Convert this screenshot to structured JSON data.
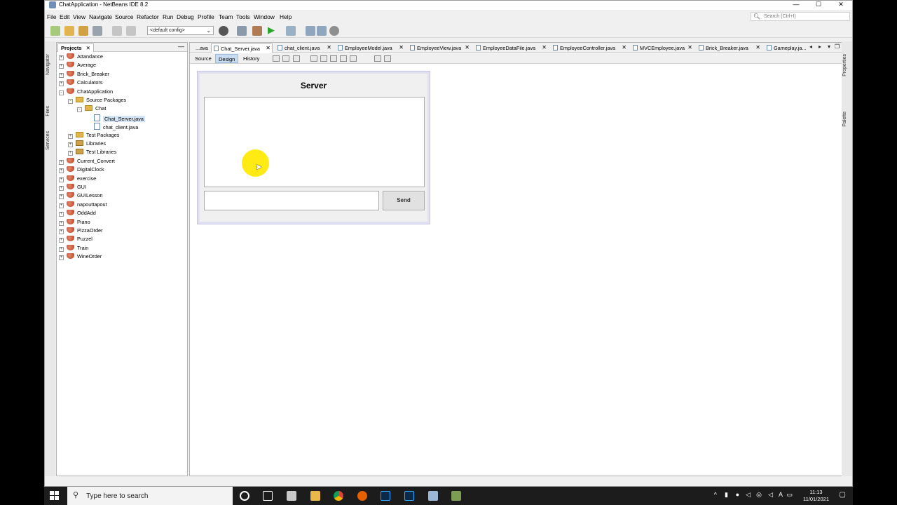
{
  "window": {
    "title": "ChatApplication - NetBeans IDE 8.2"
  },
  "menubar": {
    "items": [
      "File",
      "Edit",
      "View",
      "Navigate",
      "Source",
      "Refactor",
      "Run",
      "Debug",
      "Profile",
      "Team",
      "Tools",
      "Window",
      "Help"
    ],
    "search_placeholder": "Search (Ctrl+I)"
  },
  "toolbar": {
    "config": "<default config>"
  },
  "side_tabs": {
    "left": [
      "Navigator",
      "Files",
      "Services"
    ],
    "right": [
      "Properties",
      "Palette"
    ]
  },
  "projects": {
    "tab_label": "Projects",
    "tree": [
      {
        "label": "Attandance",
        "depth": 0,
        "kind": "project",
        "expander": "+"
      },
      {
        "label": "Average",
        "depth": 0,
        "kind": "project",
        "expander": "+"
      },
      {
        "label": "Brick_Breaker",
        "depth": 0,
        "kind": "project",
        "expander": "+"
      },
      {
        "label": "Calculators",
        "depth": 0,
        "kind": "project",
        "expander": "+"
      },
      {
        "label": "ChatApplication",
        "depth": 0,
        "kind": "project",
        "expander": "-"
      },
      {
        "label": "Source Packages",
        "depth": 1,
        "kind": "folder",
        "expander": "-"
      },
      {
        "label": "Chat",
        "depth": 2,
        "kind": "folder",
        "expander": "-"
      },
      {
        "label": "Chat_Server.java",
        "depth": 3,
        "kind": "file",
        "expander": "",
        "selected": true
      },
      {
        "label": "chat_client.java",
        "depth": 3,
        "kind": "file",
        "expander": ""
      },
      {
        "label": "Test Packages",
        "depth": 1,
        "kind": "folder",
        "expander": "+"
      },
      {
        "label": "Libraries",
        "depth": 1,
        "kind": "lib",
        "expander": "+"
      },
      {
        "label": "Test Libraries",
        "depth": 1,
        "kind": "lib",
        "expander": "+"
      },
      {
        "label": "Current_Convert",
        "depth": 0,
        "kind": "project",
        "expander": "+"
      },
      {
        "label": "DigitalClock",
        "depth": 0,
        "kind": "project",
        "expander": "+"
      },
      {
        "label": "exercise",
        "depth": 0,
        "kind": "project",
        "expander": "+"
      },
      {
        "label": "GUI",
        "depth": 0,
        "kind": "project",
        "expander": "+"
      },
      {
        "label": "GUILesson",
        "depth": 0,
        "kind": "project",
        "expander": "+"
      },
      {
        "label": "napouttapout",
        "depth": 0,
        "kind": "project",
        "expander": "+"
      },
      {
        "label": "OddAdd",
        "depth": 0,
        "kind": "project",
        "expander": "+"
      },
      {
        "label": "Piano",
        "depth": 0,
        "kind": "project",
        "expander": "+"
      },
      {
        "label": "PizzaOrder",
        "depth": 0,
        "kind": "project",
        "expander": "+"
      },
      {
        "label": "Puzzel",
        "depth": 0,
        "kind": "project",
        "expander": "+"
      },
      {
        "label": "Train",
        "depth": 0,
        "kind": "project",
        "expander": "+"
      },
      {
        "label": "WineOrder",
        "depth": 0,
        "kind": "project",
        "expander": "+"
      }
    ]
  },
  "editor": {
    "tabs": [
      {
        "label": "...ava",
        "close": false
      },
      {
        "label": "Chat_Server.java",
        "active": true
      },
      {
        "label": "chat_client.java"
      },
      {
        "label": "EmployeeModel.java"
      },
      {
        "label": "EmployeeView.java"
      },
      {
        "label": "EmployeeDataFile.java"
      },
      {
        "label": "EmployeeController.java"
      },
      {
        "label": "MVCEmployee.java"
      },
      {
        "label": "Brick_Breaker.java"
      },
      {
        "label": "Gameplay.ja..."
      }
    ],
    "views": [
      "Source",
      "Design",
      "History"
    ],
    "active_view": "Design"
  },
  "form": {
    "title": "Server",
    "send_label": "Send"
  },
  "taskbar": {
    "search_placeholder": "Type here to search",
    "time": "11:13",
    "date": "11/01/2021"
  }
}
